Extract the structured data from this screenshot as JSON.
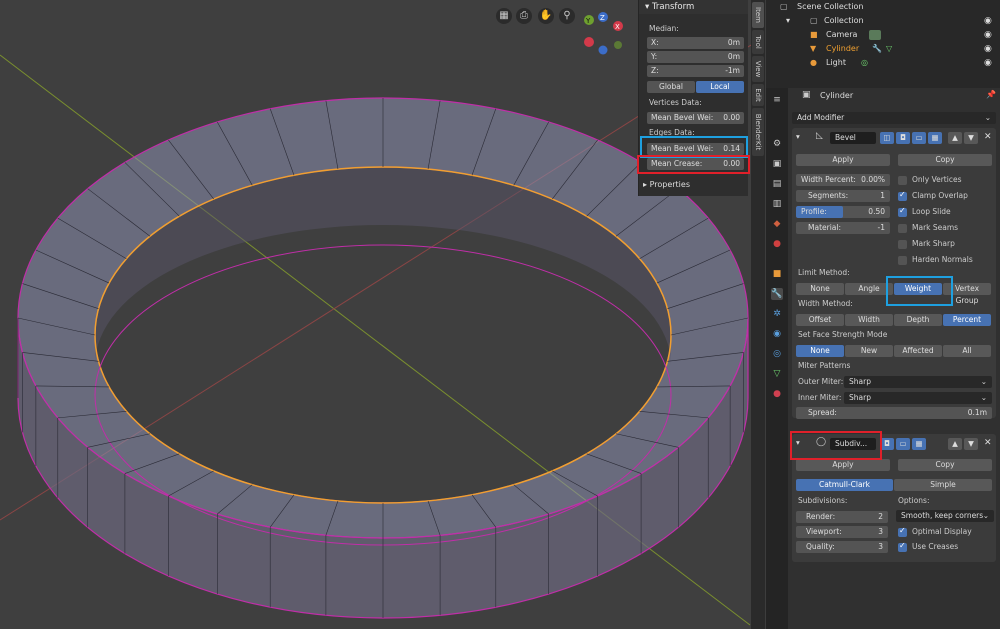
{
  "viewport": {
    "nav_icons": [
      "grid-icon",
      "camera-icon",
      "hand-icon",
      "zoom-icon"
    ],
    "gizmo": {
      "x_label": "X",
      "y_label": "Y",
      "z_label": "Z"
    }
  },
  "npanel": {
    "title": "Transform",
    "median_label": "Median:",
    "x": {
      "label": "X:",
      "value": "0m"
    },
    "y": {
      "label": "Y:",
      "value": "0m"
    },
    "z": {
      "label": "Z:",
      "value": "-1m"
    },
    "global_label": "Global",
    "local_label": "Local",
    "vertices_data_label": "Vertices Data:",
    "vert_bevel": {
      "label": "Mean Bevel Wei:",
      "value": "0.00"
    },
    "edges_data_label": "Edges Data:",
    "edge_bevel": {
      "label": "Mean Bevel Wei:",
      "value": "0.14"
    },
    "crease": {
      "label": "Mean Crease:",
      "value": "0.00"
    },
    "properties_label": "Properties"
  },
  "vtabs": [
    "Item",
    "Tool",
    "View",
    "Edit",
    "BlenderKit"
  ],
  "outliner": {
    "root": "Scene Collection",
    "collection": "Collection",
    "items": [
      "Camera",
      "Cylinder",
      "Light"
    ]
  },
  "props": {
    "object_name": "Cylinder",
    "add_modifier": "Add Modifier",
    "bevel": {
      "name": "Bevel",
      "apply": "Apply",
      "copy": "Copy",
      "width_percent": {
        "label": "Width Percent:",
        "value": "0.00%"
      },
      "segments": {
        "label": "Segments:",
        "value": "1"
      },
      "profile": {
        "label": "Profile:",
        "value": "0.50",
        "fraction": 0.5
      },
      "material": {
        "label": "Material:",
        "value": "-1"
      },
      "checks": [
        {
          "label": "Only Vertices",
          "on": false
        },
        {
          "label": "Clamp Overlap",
          "on": true
        },
        {
          "label": "Loop Slide",
          "on": true
        },
        {
          "label": "Mark Seams",
          "on": false
        },
        {
          "label": "Mark Sharp",
          "on": false
        },
        {
          "label": "Harden Normals",
          "on": false
        }
      ],
      "limit_method_label": "Limit Method:",
      "limit_methods": [
        "None",
        "Angle",
        "Weight",
        "Vertex Group"
      ],
      "width_method_label": "Width Method:",
      "width_methods": [
        "Offset",
        "Width",
        "Depth",
        "Percent"
      ],
      "face_strength_label": "Set Face Strength Mode",
      "face_strengths": [
        "None",
        "New",
        "Affected",
        "All"
      ],
      "miter_label": "Miter Patterns",
      "outer_miter": {
        "label": "Outer Miter:",
        "value": "Sharp"
      },
      "inner_miter": {
        "label": "Inner Miter:",
        "value": "Sharp"
      },
      "spread": {
        "label": "Spread:",
        "value": "0.1m"
      }
    },
    "subdiv": {
      "name": "Subdiv...",
      "apply": "Apply",
      "copy": "Copy",
      "catmull": "Catmull-Clark",
      "simple": "Simple",
      "subdivisions_label": "Subdivisions:",
      "render": {
        "label": "Render:",
        "value": "2"
      },
      "viewport": {
        "label": "Viewport:",
        "value": "3"
      },
      "quality": {
        "label": "Quality:",
        "value": "3"
      },
      "options_label": "Options:",
      "uv_smooth": "Smooth, keep corners",
      "optimal_display": "Optimal Display",
      "use_creases": "Use Creases"
    }
  },
  "colors": {
    "accent": "#4772b3",
    "highlight_blue": "#1ea0e0",
    "highlight_red": "#e0202a",
    "edge_magenta": "#d02fb0",
    "edge_orange": "#f0a030"
  }
}
